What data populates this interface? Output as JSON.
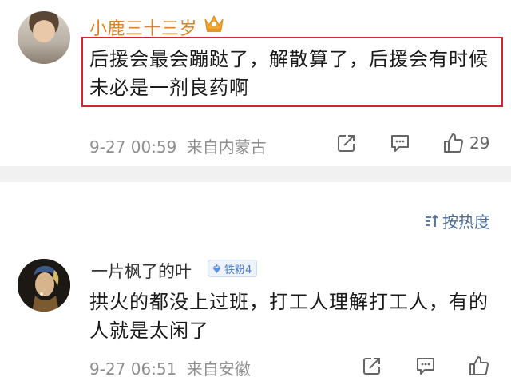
{
  "comments": [
    {
      "username": "小鹿三十三岁",
      "text": "后援会最会蹦跶了，解散算了，后援会有时候未必是一剂良药啊",
      "timestamp": "9-27 00:59",
      "location": "来自内蒙古",
      "like_count": "29",
      "highlighted": true,
      "highlight_color": "#d6242f",
      "username_color": "#e0811d"
    },
    {
      "username": "一片枫了的叶",
      "fan_badge": "铁粉4",
      "text": "拱火的都没上过班，打工人理解打工人，有的人就是太闲了",
      "timestamp": "9-27 06:51",
      "location": "来自安徽",
      "like_count": ""
    }
  ],
  "sort": {
    "label": "按热度",
    "icon": "sort-icon"
  },
  "icons": {
    "share": "share-icon",
    "comment": "comment-icon",
    "like": "thumbs-up-icon",
    "crown": "crown-icon",
    "badge": "diamond-icon"
  },
  "colors": {
    "sort_link": "#4a6b97",
    "meta_text": "#8e8e8e",
    "divider": "#f1f1f1"
  }
}
